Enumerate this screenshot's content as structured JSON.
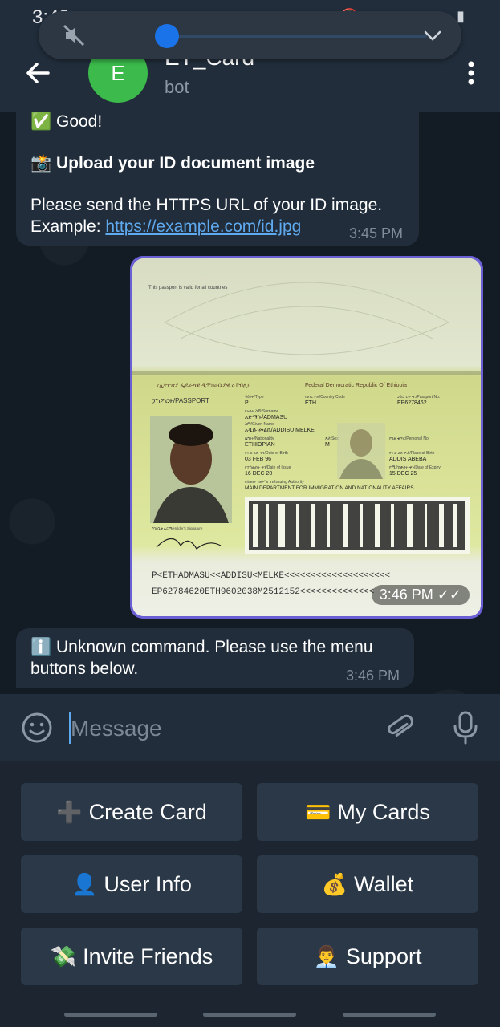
{
  "status_bar": {
    "time": "3:49",
    "left_icons": "▣ ◉ ⓕ •",
    "right_icons": "🔕 ▮ ◔ ▲ ▮"
  },
  "volume": {
    "level": 0.04
  },
  "header": {
    "avatar_letter": "E",
    "title": "ET_Card",
    "subtitle": "bot"
  },
  "messages": {
    "m1": {
      "line1": "✅ Good!",
      "line2": "📸 Upload your ID document image",
      "line3": "Please send the HTTPS URL of your ID image.",
      "line4_prefix": "Example: ",
      "line4_link": "https://example.com/id.jpg",
      "time": "3:45 PM"
    },
    "photo": {
      "time": "3:46 PM",
      "read_ticks": "✓✓",
      "passport": {
        "top_text": "This passport is valid for all countries",
        "header_amharic": "የኢትዮጵያ ፌዴራላዊ ዲሞክራሲያዊ ሪፐብሊክ",
        "header_en": "Federal Democratic Republic Of Ethiopia",
        "doc_label": "ፓስፖርት/PASSPORT",
        "type_label": "ዓይነት/Type",
        "type_value": "P",
        "country_label": "የሀገር ኮድ/Country Code",
        "country_value": "ETH",
        "passno_label": "ፓስፖርት ቁ./Passport No.",
        "passno_value": "EP6278462",
        "surname_label": "የአባት ስም/Surname",
        "surname_value": "አድማሱ/ADMASU",
        "given_label": "ስም/Given Name",
        "given_value": "አዲሱ መልኬ/ADDISU MELKE",
        "nationality_label": "ዜግነት/Nationality",
        "nationality_value": "ETHIOPIAN",
        "sex_label": "ፆታ/Sex",
        "sex_value": "M",
        "personal_label": "የግል ቁጥር/Personal No.",
        "dob_label": "የትውልድ ቀን/Date of Birth",
        "dob_value": "03 FEB 96",
        "pob_label": "የትውልድ ቦታ/Place of Birth",
        "pob_value": "ADDIS ABEBA",
        "issue_label": "የተሰጠበት ቀን/Date of Issue",
        "issue_value": "16 DEC 20",
        "expiry_label": "የሚያበቃበት ቀን/Date of Expiry",
        "expiry_value": "15 DEC 25",
        "authority_label": "የሰጠው ባለሥልጣን/Issuing Authority",
        "authority_value": "MAIN DEPARTMENT FOR IMMIGRATION AND NATIONALITY AFFAIRS",
        "signature_label": "የባለቤቱ ፊርማ/Holder's Signature",
        "mrz1": "P<ETHADMASU<<ADDISU<MELKE<<<<<<<<<<<<<<<<<<<<",
        "mrz2": "EP62784620ETH9602038M2512152<<<<<<<<<<<<<<"
      }
    },
    "m3": {
      "line1": "ℹ️ Unknown command. Please use the menu",
      "line2": "buttons below.",
      "time": "3:46 PM"
    }
  },
  "input": {
    "placeholder": "Message"
  },
  "keyboard": [
    {
      "emoji": "➕",
      "label": "Create Card"
    },
    {
      "emoji": "💳",
      "label": "My Cards"
    },
    {
      "emoji": "👤",
      "label": "User Info"
    },
    {
      "emoji": "💰",
      "label": "Wallet"
    },
    {
      "emoji": "💸",
      "label": "Invite Friends"
    },
    {
      "emoji": "👨‍💼",
      "label": "Support"
    }
  ],
  "colors": {
    "header": "#212d3b",
    "bubble_in": "#212d3b",
    "link": "#5fa9ee",
    "photo_border": "#6b5fd6",
    "avatar": "#3cba4b",
    "kb_button": "#2b3847"
  }
}
